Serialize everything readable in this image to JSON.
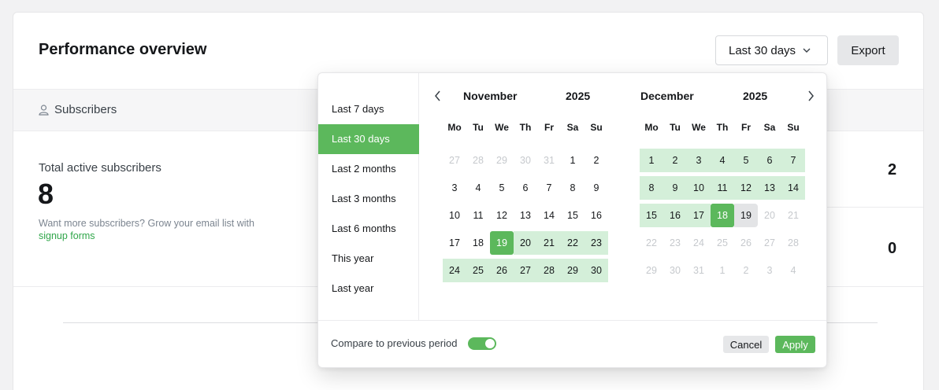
{
  "header": {
    "title": "Performance overview",
    "range_label": "Last 30 days",
    "export_label": "Export"
  },
  "tabs": {
    "subscribers_label": "Subscribers"
  },
  "stats": {
    "total_label": "Total active subscribers",
    "total_value": "8",
    "note_prefix": "Want more subscribers? Grow your email list with ",
    "note_link": "signup forms",
    "side_value_1": "2",
    "side_value_2": "0"
  },
  "picker": {
    "presets": [
      "Last 7 days",
      "Last 30 days",
      "Last 2 months",
      "Last 3 months",
      "Last 6 months",
      "This year",
      "Last year"
    ],
    "active_preset": 1,
    "weekdays": [
      "Mo",
      "Tu",
      "We",
      "Th",
      "Fr",
      "Sa",
      "Su"
    ],
    "months": [
      {
        "name": "November",
        "year": "2025",
        "weeks": [
          [
            {
              "d": "27",
              "s": "out"
            },
            {
              "d": "28",
              "s": "out"
            },
            {
              "d": "29",
              "s": "out"
            },
            {
              "d": "30",
              "s": "out"
            },
            {
              "d": "31",
              "s": "out"
            },
            {
              "d": "1",
              "s": ""
            },
            {
              "d": "2",
              "s": ""
            }
          ],
          [
            {
              "d": "3",
              "s": ""
            },
            {
              "d": "4",
              "s": ""
            },
            {
              "d": "5",
              "s": ""
            },
            {
              "d": "6",
              "s": ""
            },
            {
              "d": "7",
              "s": ""
            },
            {
              "d": "8",
              "s": ""
            },
            {
              "d": "9",
              "s": ""
            }
          ],
          [
            {
              "d": "10",
              "s": ""
            },
            {
              "d": "11",
              "s": ""
            },
            {
              "d": "12",
              "s": ""
            },
            {
              "d": "13",
              "s": ""
            },
            {
              "d": "14",
              "s": ""
            },
            {
              "d": "15",
              "s": ""
            },
            {
              "d": "16",
              "s": ""
            }
          ],
          [
            {
              "d": "17",
              "s": ""
            },
            {
              "d": "18",
              "s": ""
            },
            {
              "d": "19",
              "s": "sel"
            },
            {
              "d": "20",
              "s": "range"
            },
            {
              "d": "21",
              "s": "range"
            },
            {
              "d": "22",
              "s": "range"
            },
            {
              "d": "23",
              "s": "range"
            }
          ],
          [
            {
              "d": "24",
              "s": "range"
            },
            {
              "d": "25",
              "s": "range"
            },
            {
              "d": "26",
              "s": "range"
            },
            {
              "d": "27",
              "s": "range"
            },
            {
              "d": "28",
              "s": "range"
            },
            {
              "d": "29",
              "s": "range"
            },
            {
              "d": "30",
              "s": "range"
            }
          ]
        ]
      },
      {
        "name": "December",
        "year": "2025",
        "weeks": [
          [
            {
              "d": "1",
              "s": "range"
            },
            {
              "d": "2",
              "s": "range"
            },
            {
              "d": "3",
              "s": "range"
            },
            {
              "d": "4",
              "s": "range"
            },
            {
              "d": "5",
              "s": "range"
            },
            {
              "d": "6",
              "s": "range"
            },
            {
              "d": "7",
              "s": "range"
            }
          ],
          [
            {
              "d": "8",
              "s": "range"
            },
            {
              "d": "9",
              "s": "range"
            },
            {
              "d": "10",
              "s": "range"
            },
            {
              "d": "11",
              "s": "range"
            },
            {
              "d": "12",
              "s": "range"
            },
            {
              "d": "13",
              "s": "range"
            },
            {
              "d": "14",
              "s": "range"
            }
          ],
          [
            {
              "d": "15",
              "s": "range"
            },
            {
              "d": "16",
              "s": "range"
            },
            {
              "d": "17",
              "s": "range"
            },
            {
              "d": "18",
              "s": "sel"
            },
            {
              "d": "19",
              "s": "today"
            },
            {
              "d": "20",
              "s": "out"
            },
            {
              "d": "21",
              "s": "out"
            }
          ],
          [
            {
              "d": "22",
              "s": "out"
            },
            {
              "d": "23",
              "s": "out"
            },
            {
              "d": "24",
              "s": "out"
            },
            {
              "d": "25",
              "s": "out"
            },
            {
              "d": "26",
              "s": "out"
            },
            {
              "d": "27",
              "s": "out"
            },
            {
              "d": "28",
              "s": "out"
            }
          ],
          [
            {
              "d": "29",
              "s": "out"
            },
            {
              "d": "30",
              "s": "out"
            },
            {
              "d": "31",
              "s": "out"
            },
            {
              "d": "1",
              "s": "out"
            },
            {
              "d": "2",
              "s": "out"
            },
            {
              "d": "3",
              "s": "out"
            },
            {
              "d": "4",
              "s": "out"
            }
          ]
        ]
      }
    ],
    "compare_label": "Compare to previous period",
    "compare_on": true,
    "cancel_label": "Cancel",
    "apply_label": "Apply"
  },
  "icons": {
    "range_chevron": "chevron-down-icon",
    "prev": "chevron-left-icon",
    "next": "chevron-right-icon",
    "subscribers": "user-icon"
  },
  "colors": {
    "accent": "#5cb85c",
    "range_fill": "#d4efd9",
    "today_fill": "#e3e4e6"
  }
}
